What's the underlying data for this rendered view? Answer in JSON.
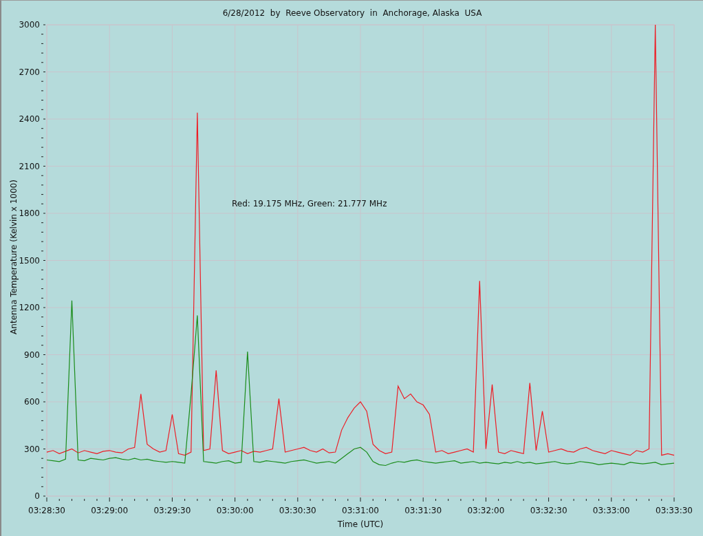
{
  "chart": {
    "chart_data": {
      "type": "line",
      "title": "6/28/2012  by  Reeve Observatory  in  Anchorage, Alaska  USA",
      "xlabel": "Time (UTC)",
      "ylabel": "Antenna Temperature (Kelvin x 1000)",
      "categories": [
        "03:28:30",
        null,
        null,
        null,
        null,
        null,
        null,
        null,
        null,
        null,
        "03:29:00",
        null,
        null,
        null,
        null,
        null,
        null,
        null,
        null,
        null,
        "03:29:30",
        null,
        null,
        null,
        null,
        null,
        null,
        null,
        null,
        null,
        "03:30:00",
        null,
        null,
        null,
        null,
        null,
        null,
        null,
        null,
        null,
        "03:30:30",
        null,
        null,
        null,
        null,
        null,
        null,
        null,
        null,
        null,
        "03:31:00",
        null,
        null,
        null,
        null,
        null,
        null,
        null,
        null,
        null,
        "03:31:30",
        null,
        null,
        null,
        null,
        null,
        null,
        null,
        null,
        null,
        "03:32:00",
        null,
        null,
        null,
        null,
        null,
        null,
        null,
        null,
        null,
        "03:32:30",
        null,
        null,
        null,
        null,
        null,
        null,
        null,
        null,
        null,
        "03:33:00",
        null,
        null,
        null,
        null,
        null,
        null,
        null,
        null,
        null,
        "03:33:30"
      ],
      "series": [
        {
          "color": "#ee1c24",
          "values": [
            280,
            290,
            270,
            285,
            300,
            275,
            290,
            280,
            270,
            285,
            290,
            280,
            275,
            300,
            310,
            650,
            330,
            300,
            280,
            290,
            520,
            270,
            260,
            280,
            2440,
            290,
            300,
            800,
            290,
            270,
            280,
            290,
            270,
            285,
            280,
            290,
            300,
            620,
            280,
            290,
            300,
            310,
            290,
            280,
            300,
            275,
            280,
            420,
            500,
            560,
            600,
            540,
            330,
            290,
            270,
            280,
            700,
            620,
            650,
            600,
            580,
            520,
            280,
            290,
            270,
            280,
            290,
            300,
            280,
            1370,
            300,
            710,
            280,
            270,
            290,
            280,
            270,
            720,
            290,
            540,
            280,
            290,
            300,
            285,
            280,
            300,
            310,
            290,
            280,
            270,
            290,
            280,
            270,
            260,
            290,
            280,
            300,
            3000,
            260,
            270,
            260
          ]
        },
        {
          "color": "#1a8c1a",
          "values": [
            230,
            225,
            220,
            235,
            1245,
            230,
            225,
            240,
            235,
            230,
            240,
            245,
            235,
            230,
            240,
            230,
            235,
            225,
            220,
            215,
            220,
            215,
            210,
            650,
            1150,
            220,
            215,
            210,
            220,
            225,
            210,
            215,
            920,
            220,
            215,
            225,
            220,
            215,
            210,
            220,
            225,
            230,
            220,
            210,
            215,
            220,
            210,
            240,
            270,
            300,
            310,
            280,
            220,
            200,
            195,
            210,
            220,
            215,
            225,
            230,
            220,
            215,
            210,
            215,
            220,
            225,
            210,
            215,
            220,
            210,
            215,
            210,
            205,
            215,
            210,
            220,
            210,
            215,
            205,
            210,
            215,
            220,
            210,
            205,
            210,
            220,
            215,
            210,
            200,
            205,
            210,
            205,
            200,
            215,
            210,
            205,
            210,
            215,
            200,
            205,
            210
          ]
        }
      ],
      "ylim": [
        0,
        3000
      ],
      "grid": true,
      "yticks": [
        0,
        300,
        600,
        900,
        1200,
        1500,
        1800,
        2100,
        2400,
        2700,
        3000
      ],
      "annotations": [
        "Red: 19.175 MHz, Green: 21.777 MHz"
      ]
    }
  }
}
